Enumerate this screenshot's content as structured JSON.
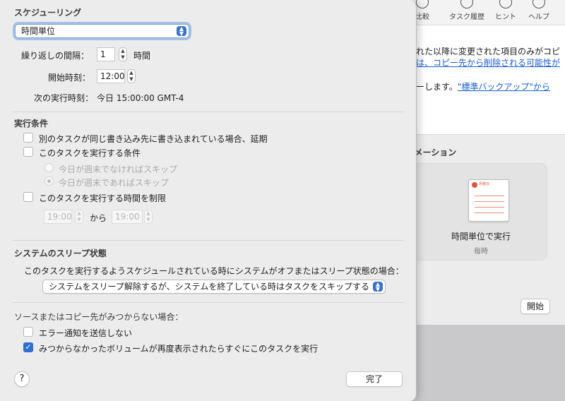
{
  "toolbar": {
    "items": [
      {
        "label": "比較",
        "icon": "compare-icon"
      },
      {
        "label": "タスク履歴",
        "icon": "clock-icon"
      },
      {
        "label": "ヒント",
        "icon": "lightbulb-icon"
      },
      {
        "label": "ヘルプ",
        "icon": "question-icon"
      }
    ]
  },
  "background": {
    "line1": "れた以降に変更された項目のみがコピ",
    "line2": "は、コピー先から削除される可能性が",
    "line3_prefix": "ーします。",
    "line3_link": "\"標準バックアップ\"から",
    "automation_title": "ーメーション",
    "calendar_header": "月曜日",
    "automation_label": "時間単位で実行",
    "automation_sub": "毎時",
    "start_button": "開始"
  },
  "sheet": {
    "scheduling_title": "スケジューリング",
    "frequency": {
      "selected": "時間単位"
    },
    "repeat": {
      "label": "繰り返しの間隔：",
      "value": "1",
      "unit": "時間"
    },
    "start_time": {
      "label": "開始時刻：",
      "value": "12:00"
    },
    "next_run": {
      "label": "次の実行時刻：",
      "value": "今日 15:00:00 GMT-4"
    },
    "conditions_title": "実行条件",
    "defer_label": "別のタスクが同じ書き込み先に書き込まれている場合、延期",
    "condition_label": "このタスクを実行する条件",
    "skip_weekday_label": "今日が週末でなければスキップ",
    "skip_weekend_label": "今日が週末であればスキップ",
    "limit_label": "このタスクを実行する時間を制限",
    "limit_from": "19:00",
    "limit_to_word": "から",
    "limit_to": "19:00",
    "sleep_title": "システムのスリープ状態",
    "sleep_desc": "このタスクを実行するようスケジュールされている時にシステムがオフまたはスリープ状態の場合：",
    "sleep_option": "システムをスリープ解除するが、システムを終了している時はタスクをスキップする",
    "missing_title": "ソースまたはコピー先がみつからない場合：",
    "no_error_label": "エラー通知を送信しない",
    "run_on_reappear_label": "みつからなかったボリュームが再度表示されたらすぐにこのタスクを実行",
    "help": "?",
    "done": "完了"
  }
}
